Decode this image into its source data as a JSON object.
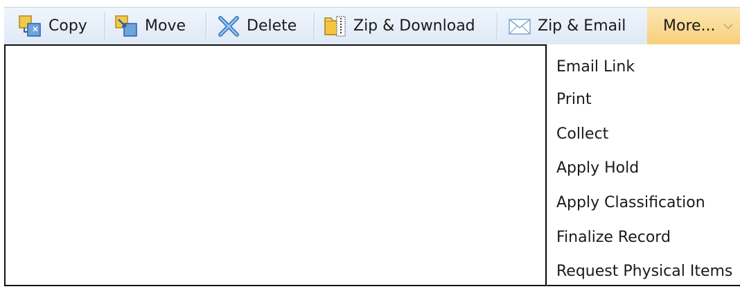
{
  "toolbar": {
    "copy_label": "Copy",
    "move_label": "Move",
    "delete_label": "Delete",
    "zip_download_label": "Zip & Download",
    "zip_email_label": "Zip & Email",
    "more_label": "More..."
  },
  "icons": {
    "copy": "copy-icon",
    "move": "move-icon",
    "delete": "delete-icon",
    "zip_download": "zip-folder-icon",
    "zip_email": "envelope-icon",
    "more": "chevron-down-icon"
  },
  "colors": {
    "toolbar_bg": "#e4edf8",
    "more_highlight": "#f9d98e",
    "border": "#111111"
  },
  "menu": {
    "items": [
      {
        "label": "Email Link"
      },
      {
        "label": "Print"
      },
      {
        "label": "Collect"
      },
      {
        "label": "Apply Hold"
      },
      {
        "label": "Apply Classification"
      },
      {
        "label": "Finalize Record"
      },
      {
        "label": "Request Physical Items"
      }
    ]
  }
}
